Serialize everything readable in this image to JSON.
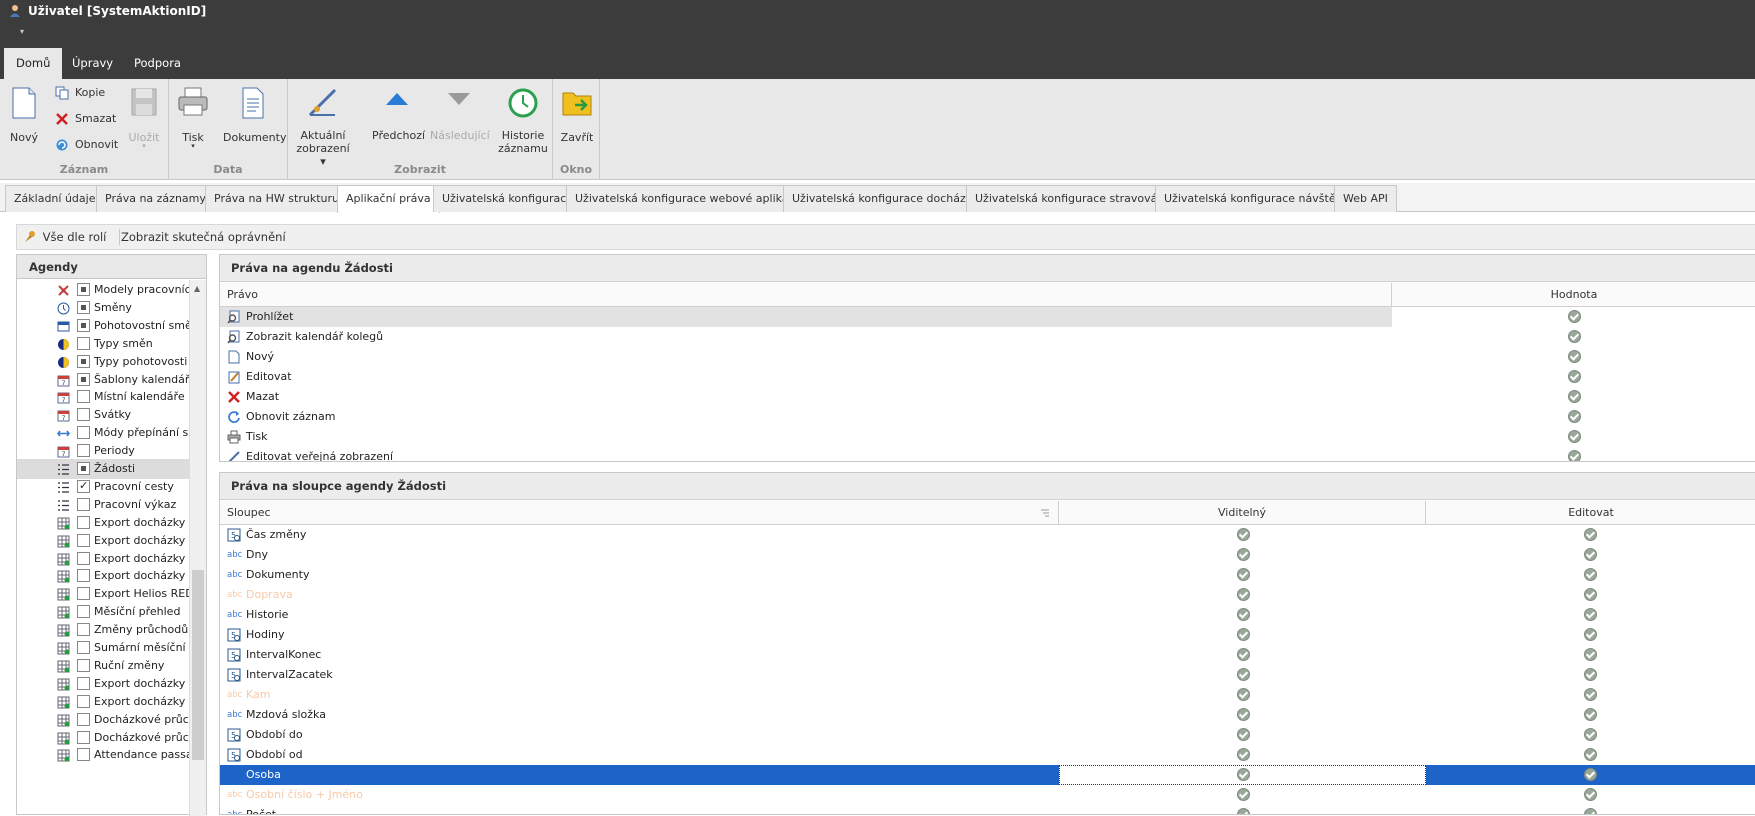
{
  "window": {
    "title": "Uživatel [SystemAktionID]",
    "qa_arrow": "▾"
  },
  "menu": {
    "tabs": [
      "Domů",
      "Úpravy",
      "Podpora"
    ]
  },
  "ribbon": {
    "groups": {
      "zaznam": "Záznam",
      "data": "Data",
      "zobrazit": "Zobrazit",
      "okno": "Okno"
    },
    "novy": "Nový",
    "kopie": "Kopie",
    "smazat": "Smazat",
    "obnovit": "Obnovit",
    "ulozit": "Uložit",
    "tisk": "Tisk",
    "dokumenty": "Dokumenty",
    "aktualni_1": "Aktuální",
    "aktualni_2": "zobrazení ▾",
    "predchozi": "Předchozí",
    "nasledujici": "Následující",
    "historie_1": "Historie",
    "historie_2": "záznamu",
    "zavrit": "Zavřít"
  },
  "tabs": [
    "Základní údaje",
    "Práva na záznamy",
    "Práva na HW strukturu",
    "Aplikační práva",
    "Uživatelská konfigurace",
    "Uživatelská konfigurace webové aplikace",
    "Uživatelská konfigurace docházky",
    "Uživatelská konfigurace stravování",
    "Uživatelská konfigurace návštěv",
    "Web API"
  ],
  "toolbar": {
    "vse": "Vše dle rolí",
    "zobrazit": "Zobrazit skutečná oprávnění"
  },
  "agendy": {
    "title": "Agendy",
    "items": [
      {
        "label": "Modely pracovních",
        "icon": "model-icon",
        "check": "ind"
      },
      {
        "label": "Směny",
        "icon": "clock-icon",
        "check": "ind"
      },
      {
        "label": "Pohotovostní směn",
        "icon": "standby-icon",
        "check": "ind"
      },
      {
        "label": "Typy směn",
        "icon": "moon-icon",
        "check": "none"
      },
      {
        "label": "Typy pohotovosti",
        "icon": "moon-icon",
        "check": "ind"
      },
      {
        "label": "Šablony kalendářů",
        "icon": "calendar-icon",
        "check": "ind"
      },
      {
        "label": "Místní kalendáře",
        "icon": "calendar-icon",
        "check": "none"
      },
      {
        "label": "Svátky",
        "icon": "calendar-icon",
        "check": "none"
      },
      {
        "label": "Módy přepínání smě",
        "icon": "switch-icon",
        "check": "none"
      },
      {
        "label": "Periody",
        "icon": "calendar-icon",
        "check": "none"
      },
      {
        "label": "Žádosti",
        "icon": "list-icon",
        "check": "ind"
      },
      {
        "label": "Pracovní cesty",
        "icon": "list-icon",
        "check": "chk"
      },
      {
        "label": "Pracovní výkaz",
        "icon": "list-icon",
        "check": "none"
      },
      {
        "label": "Export docházky H",
        "icon": "grid-icon",
        "check": "none"
      },
      {
        "label": "Export docházky",
        "icon": "grid-icon",
        "check": "none"
      },
      {
        "label": "Export docházky O",
        "icon": "grid-icon",
        "check": "none"
      },
      {
        "label": "Export docházky Va",
        "icon": "grid-icon",
        "check": "none"
      },
      {
        "label": "Export Helios RED",
        "icon": "grid-icon",
        "check": "none"
      },
      {
        "label": "Měsíční přehled",
        "icon": "grid-icon",
        "check": "none"
      },
      {
        "label": "Změny průchodů",
        "icon": "grid-icon",
        "check": "none"
      },
      {
        "label": "Sumární měsíční pře",
        "icon": "grid-icon",
        "check": "none"
      },
      {
        "label": "Ruční změny",
        "icon": "grid-icon",
        "check": "none"
      },
      {
        "label": "Export docházky Sc",
        "icon": "grid-icon",
        "check": "none"
      },
      {
        "label": "Export docházky Li",
        "icon": "grid-icon",
        "check": "none"
      },
      {
        "label": "Docházkové průcho",
        "icon": "grid-icon",
        "check": "none"
      },
      {
        "label": "Docházkové průcho",
        "icon": "grid-icon",
        "check": "none"
      },
      {
        "label": "Attendance passac",
        "icon": "grid-icon",
        "check": "none"
      }
    ]
  },
  "prava": {
    "title": "Práva na agendu Žádosti",
    "col_pravo": "Právo",
    "col_hodnota": "Hodnota",
    "rows": [
      {
        "label": "Prohlížet",
        "icon": "view-icon"
      },
      {
        "label": "Zobrazit kalendář kolegů",
        "icon": "view-icon"
      },
      {
        "label": "Nový",
        "icon": "new-icon"
      },
      {
        "label": "Editovat",
        "icon": "edit-icon"
      },
      {
        "label": "Mazat",
        "icon": "delete-icon"
      },
      {
        "label": "Obnovit záznam",
        "icon": "refresh-icon"
      },
      {
        "label": "Tisk",
        "icon": "print-icon"
      },
      {
        "label": "Editovat veřejná zobrazení",
        "icon": "edit-view-icon"
      }
    ]
  },
  "sloupce": {
    "title": "Práva na sloupce agendy Žádosti",
    "col_sloupec": "Sloupec",
    "col_viditelny": "Viditelný",
    "col_editovat": "Editovat",
    "rows": [
      {
        "label": "Čas změny",
        "type": "date",
        "disabled": false
      },
      {
        "label": "Dny",
        "type": "abc",
        "disabled": false
      },
      {
        "label": "Dokumenty",
        "type": "abc",
        "disabled": false
      },
      {
        "label": "Doprava",
        "type": "abc",
        "disabled": true
      },
      {
        "label": "Historie",
        "type": "abc",
        "disabled": false
      },
      {
        "label": "Hodiny",
        "type": "date",
        "disabled": false
      },
      {
        "label": "IntervalKonec",
        "type": "date",
        "disabled": false
      },
      {
        "label": "IntervalZacatek",
        "type": "date",
        "disabled": false
      },
      {
        "label": "Kam",
        "type": "abc",
        "disabled": true
      },
      {
        "label": "Mzdová složka",
        "type": "abc",
        "disabled": false
      },
      {
        "label": "Období do",
        "type": "date",
        "disabled": false
      },
      {
        "label": "Období od",
        "type": "date",
        "disabled": false
      },
      {
        "label": "Osoba",
        "type": "abc",
        "disabled": false,
        "selected": true
      },
      {
        "label": "Osobní číslo + Jméno",
        "type": "abc",
        "disabled": true
      },
      {
        "label": "Počet",
        "type": "abc",
        "disabled": false
      }
    ]
  }
}
